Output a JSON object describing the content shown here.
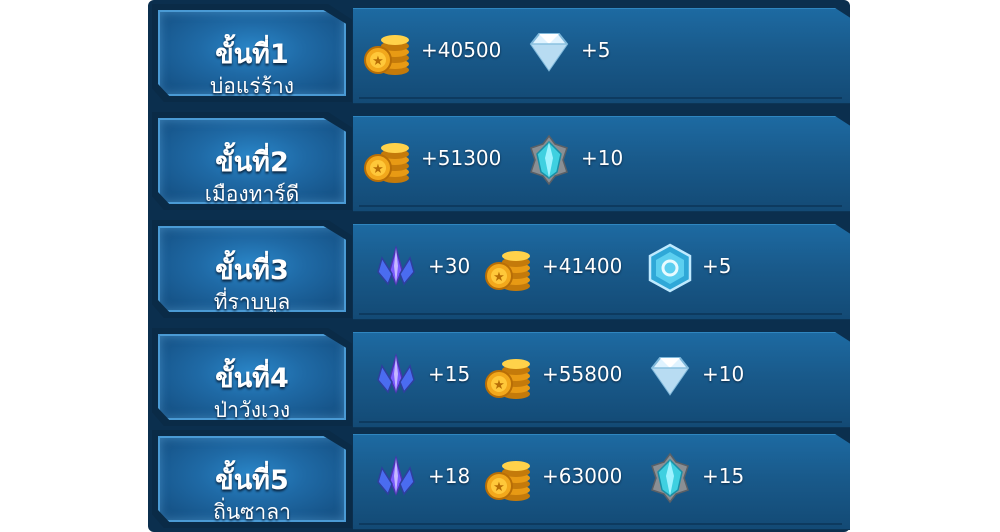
{
  "stages": [
    {
      "title": "ขั้นที่1",
      "name": "บ่อแร่ร้าง",
      "rewards": [
        {
          "icon": "gold-coins-icon",
          "amount": "+40500"
        },
        {
          "icon": "white-diamond-icon",
          "amount": "+5"
        }
      ]
    },
    {
      "title": "ขั้นที่2",
      "name": "เมืองทาร์ดี",
      "rewards": [
        {
          "icon": "gold-coins-icon",
          "amount": "+51300"
        },
        {
          "icon": "teal-crystal-icon",
          "amount": "+10"
        }
      ]
    },
    {
      "title": "ขั้นที่3",
      "name": "ที่ราบบูล",
      "rewards": [
        {
          "icon": "purple-crystal-icon",
          "amount": "+30"
        },
        {
          "icon": "gold-coins-icon",
          "amount": "+41400"
        },
        {
          "icon": "hexagon-gem-icon",
          "amount": "+5"
        }
      ]
    },
    {
      "title": "ขั้นที่4",
      "name": "ป่าวังเวง",
      "rewards": [
        {
          "icon": "purple-crystal-icon",
          "amount": "+15"
        },
        {
          "icon": "gold-coins-icon",
          "amount": "+55800"
        },
        {
          "icon": "white-diamond-icon",
          "amount": "+10"
        }
      ]
    },
    {
      "title": "ขั้นที่5",
      "name": "ถิ่นซาลา",
      "rewards": [
        {
          "icon": "purple-crystal-icon",
          "amount": "+18"
        },
        {
          "icon": "gold-coins-icon",
          "amount": "+63000"
        },
        {
          "icon": "teal-crystal-icon",
          "amount": "+15"
        }
      ]
    }
  ],
  "colors": {
    "panel": "#0b2f4e",
    "strip": "#195a8b",
    "badge_border": "#4a9ad4",
    "coin": "#f2a81c"
  }
}
